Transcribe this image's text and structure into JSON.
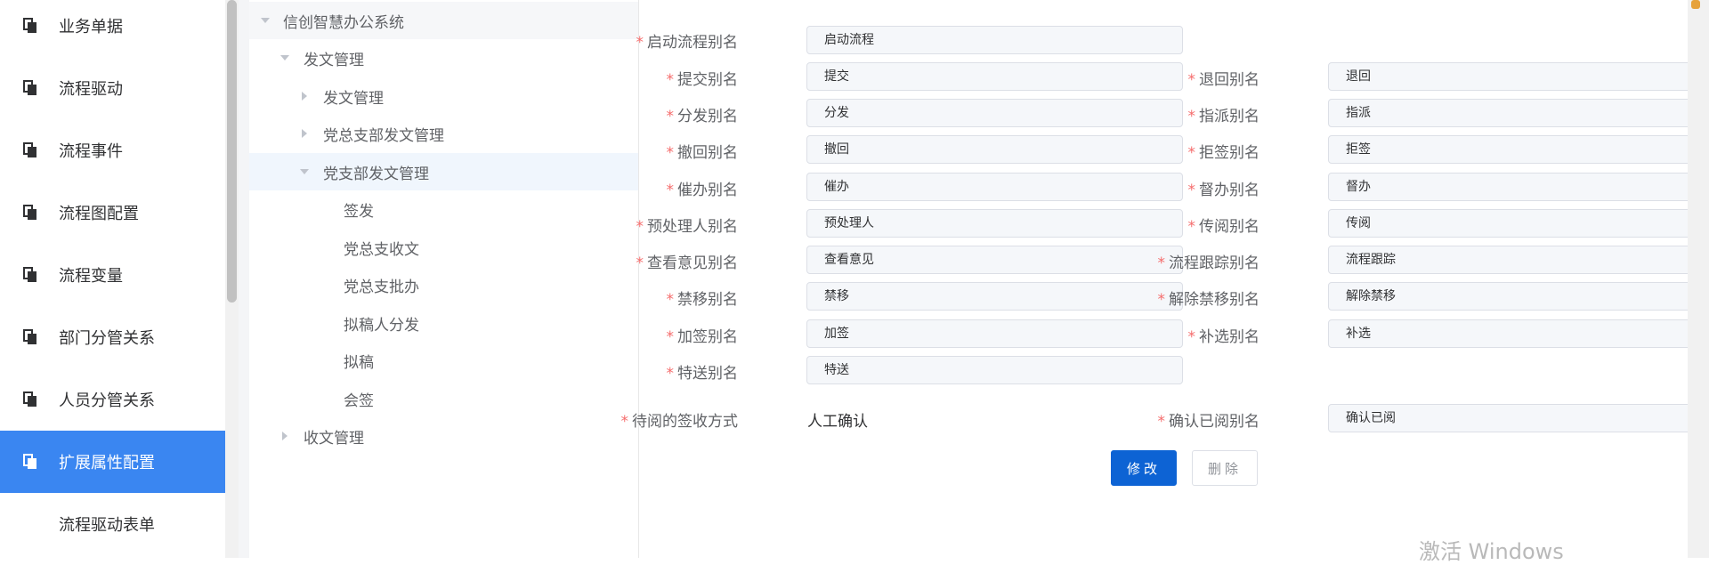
{
  "sidebar": {
    "items": [
      {
        "label": "业务单据"
      },
      {
        "label": "流程驱动"
      },
      {
        "label": "流程事件"
      },
      {
        "label": "流程图配置"
      },
      {
        "label": "流程变量"
      },
      {
        "label": "部门分管关系"
      },
      {
        "label": "人员分管关系"
      },
      {
        "label": "扩展属性配置"
      },
      {
        "label": "流程驱动表单"
      }
    ],
    "active_index": 7,
    "active_color": "#3a86f1"
  },
  "tree": {
    "nodes": [
      {
        "label": "信创智慧办公系统",
        "expanded": true
      },
      {
        "label": "发文管理",
        "expanded": true
      },
      {
        "label": "发文管理",
        "expanded": false
      },
      {
        "label": "党总支部发文管理",
        "expanded": false
      },
      {
        "label": "党支部发文管理",
        "expanded": true,
        "selected": true
      },
      {
        "label": "签发"
      },
      {
        "label": "党总支收文"
      },
      {
        "label": "党总支批办"
      },
      {
        "label": "拟稿人分发"
      },
      {
        "label": "拟稿"
      },
      {
        "label": "会签"
      },
      {
        "label": "收文管理",
        "expanded": false
      }
    ]
  },
  "form": {
    "required_mark": "*",
    "fields": {
      "start": {
        "label": "启动流程别名",
        "value": "启动流程"
      },
      "submit": {
        "label": "提交别名",
        "value": "提交"
      },
      "return": {
        "label": "退回别名",
        "value": "退回"
      },
      "distribute": {
        "label": "分发别名",
        "value": "分发"
      },
      "assign": {
        "label": "指派别名",
        "value": "指派"
      },
      "withdraw": {
        "label": "撤回别名",
        "value": "撤回"
      },
      "reject": {
        "label": "拒签别名",
        "value": "拒签"
      },
      "urge": {
        "label": "催办别名",
        "value": "催办"
      },
      "supervise": {
        "label": "督办别名",
        "value": "督办"
      },
      "preprocess": {
        "label": "预处理人别名",
        "value": "预处理人"
      },
      "circulate": {
        "label": "传阅别名",
        "value": "传阅"
      },
      "view_opinion": {
        "label": "查看意见别名",
        "value": "查看意见"
      },
      "track": {
        "label": "流程跟踪别名",
        "value": "流程跟踪"
      },
      "ban": {
        "label": "禁移别名",
        "value": "禁移"
      },
      "unban": {
        "label": "解除禁移别名",
        "value": "解除禁移"
      },
      "add_sign": {
        "label": "加签别名",
        "value": "加签"
      },
      "supplement": {
        "label": "补选别名",
        "value": "补选"
      },
      "special_send": {
        "label": "特送别名",
        "value": "特送"
      },
      "sign_mode": {
        "label": "待阅的签收方式",
        "value": "人工确认"
      },
      "confirm_read": {
        "label": "确认已阅别名",
        "value": "确认已阅"
      }
    },
    "buttons": {
      "modify": "修改",
      "delete": "删除"
    },
    "primary_color": "#0d63d4"
  },
  "watermark": "激活 Windows"
}
